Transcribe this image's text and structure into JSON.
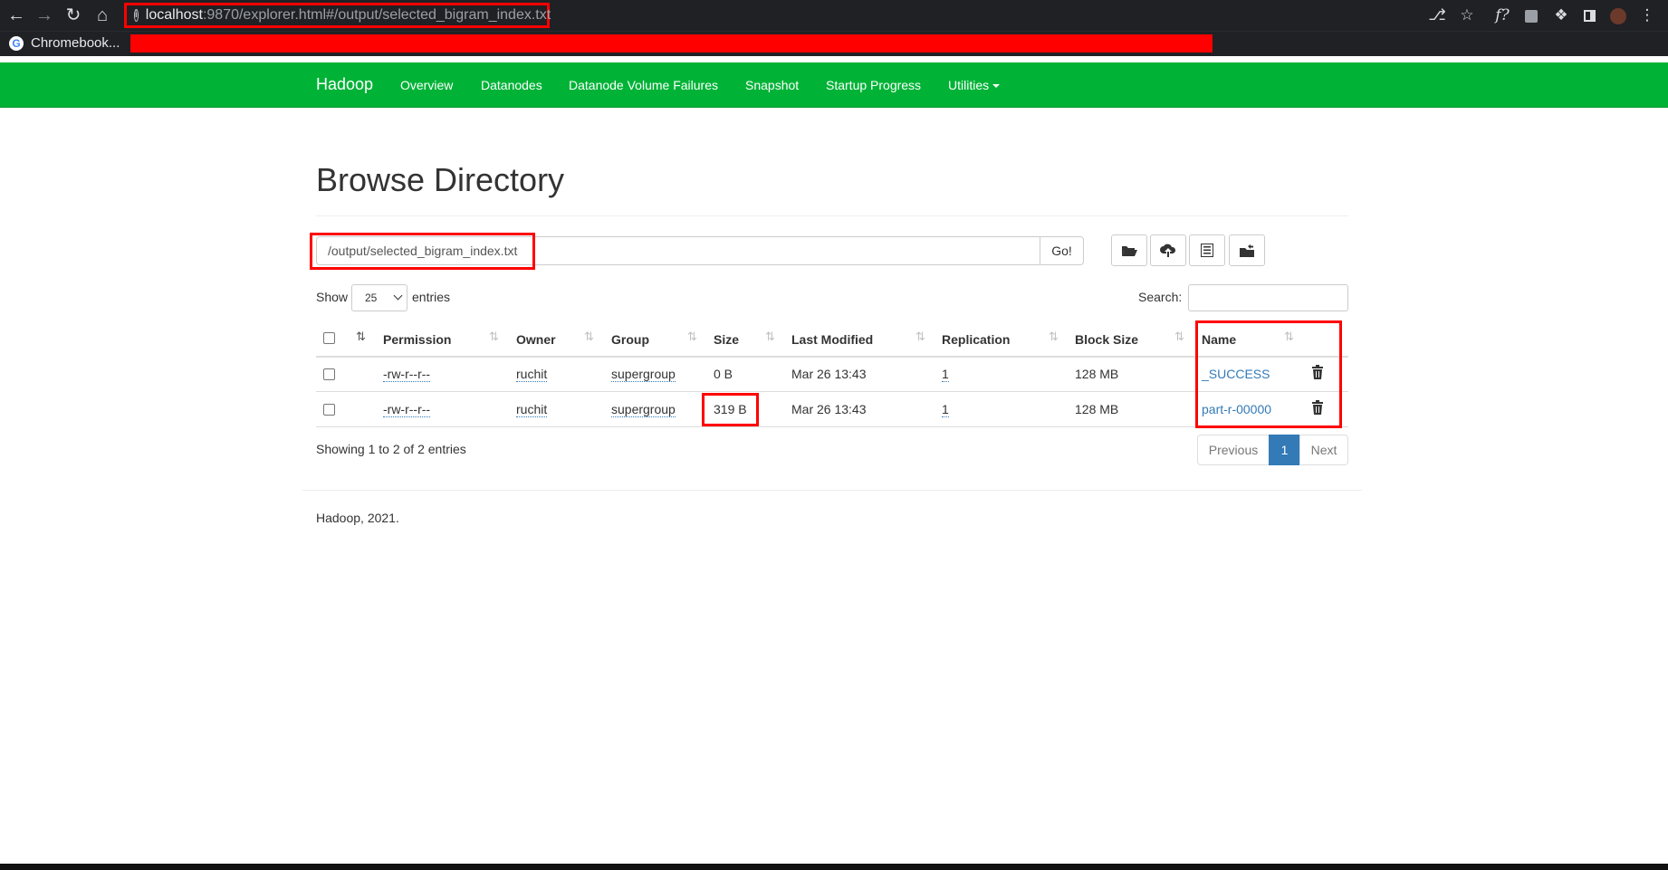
{
  "browser": {
    "url_host": "localhost",
    "url_path": ":9870/explorer.html#/output/selected_bigram_index.txt",
    "bookmark_label": "Chromebook..."
  },
  "navbar": {
    "brand": "Hadoop",
    "links": [
      "Overview",
      "Datanodes",
      "Datanode Volume Failures",
      "Snapshot",
      "Startup Progress",
      "Utilities"
    ]
  },
  "page": {
    "title": "Browse Directory",
    "path_value": "/output/selected_bigram_index.txt",
    "go_label": "Go!",
    "show_label": "Show",
    "entries_value": "25",
    "entries_label": "entries",
    "search_label": "Search:"
  },
  "table": {
    "headers": [
      "Permission",
      "Owner",
      "Group",
      "Size",
      "Last Modified",
      "Replication",
      "Block Size",
      "Name"
    ],
    "rows": [
      {
        "permission": "-rw-r--r--",
        "owner": "ruchit",
        "group": "supergroup",
        "size": "0 B",
        "modified": "Mar 26 13:43",
        "replication": "1",
        "block_size": "128 MB",
        "name": "_SUCCESS"
      },
      {
        "permission": "-rw-r--r--",
        "owner": "ruchit",
        "group": "supergroup",
        "size": "319 B",
        "modified": "Mar 26 13:43",
        "replication": "1",
        "block_size": "128 MB",
        "name": "part-r-00000"
      }
    ]
  },
  "pagination": {
    "info": "Showing 1 to 2 of 2 entries",
    "previous": "Previous",
    "current": "1",
    "next": "Next"
  },
  "footer": "Hadoop, 2021.",
  "colors": {
    "navbar": "#00b336",
    "link": "#337ab7",
    "highlight": "#ff0000"
  }
}
